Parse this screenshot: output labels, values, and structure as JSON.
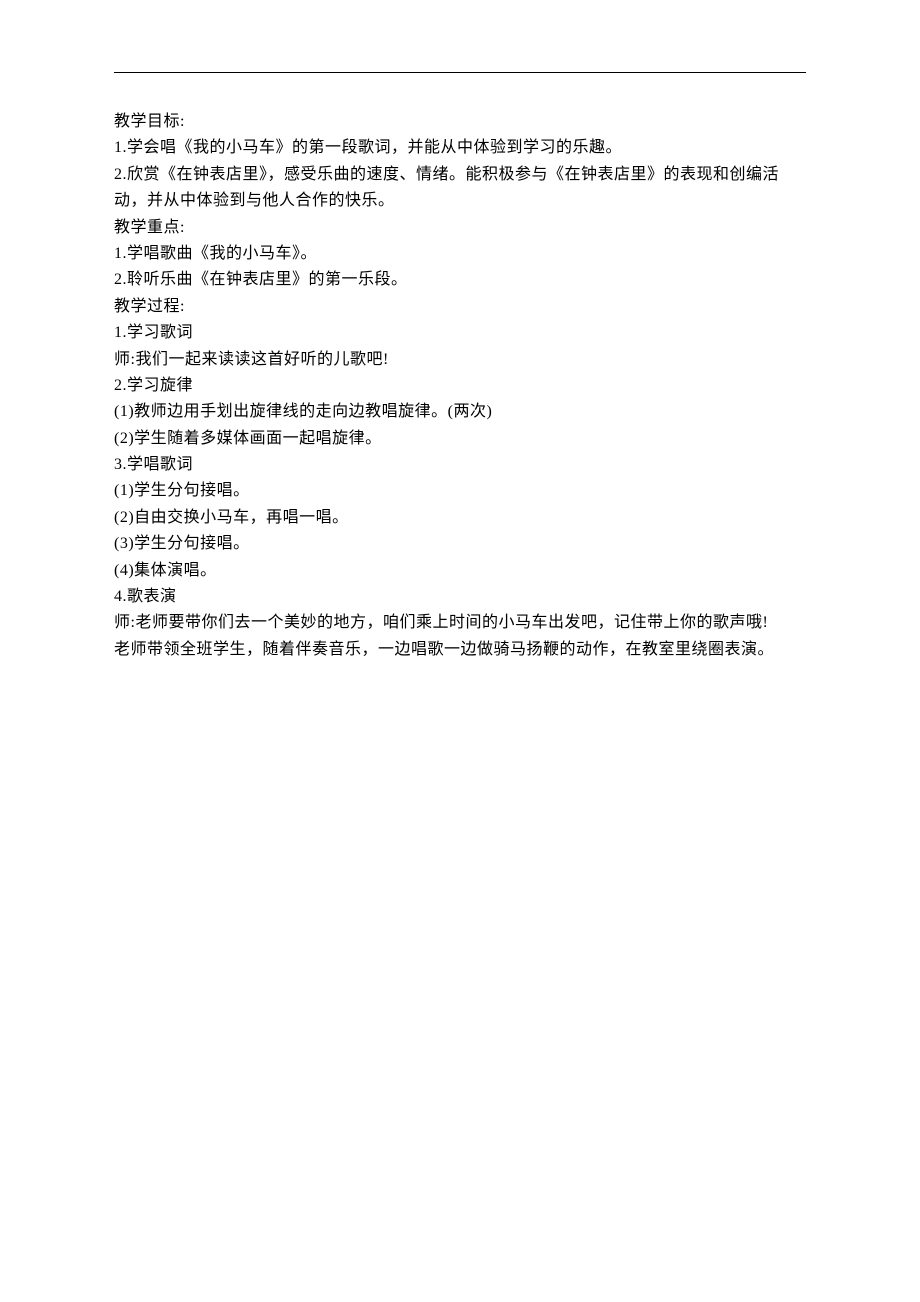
{
  "lines": [
    "教学目标:",
    "1.学会唱《我的小马车》的第一段歌词，并能从中体验到学习的乐趣。",
    "2.欣赏《在钟表店里》，感受乐曲的速度、情绪。能积极参与《在钟表店里》的表现和创编活动，并从中体验到与他人合作的快乐。",
    "教学重点:",
    "1.学唱歌曲《我的小马车》。",
    "2.聆听乐曲《在钟表店里》的第一乐段。",
    "教学过程:",
    "1.学习歌词",
    "师:我们一起来读读这首好听的儿歌吧!",
    "2.学习旋律",
    "(1)教师边用手划出旋律线的走向边教唱旋律。(两次)",
    "(2)学生随着多媒体画面一起唱旋律。",
    "3.学唱歌词",
    "(1)学生分句接唱。",
    "(2)自由交换小马车，再唱一唱。",
    "(3)学生分句接唱。",
    "(4)集体演唱。",
    "4.歌表演",
    "师:老师要带你们去一个美妙的地方，咱们乘上时间的小马车出发吧，记住带上你的歌声哦!",
    "老师带领全班学生，随着伴奏音乐，一边唱歌一边做骑马扬鞭的动作，在教室里绕圈表演。"
  ]
}
